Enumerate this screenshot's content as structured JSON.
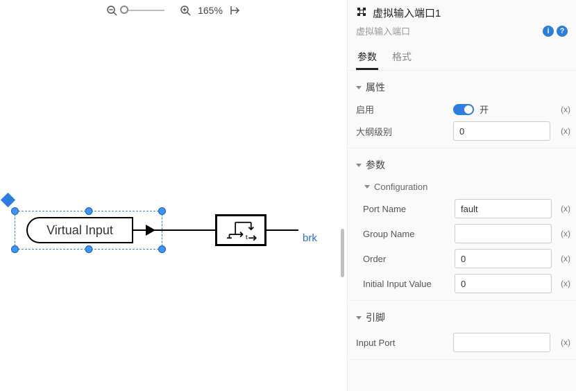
{
  "toolbar": {
    "zoom_value": "165%"
  },
  "canvas": {
    "virtual_input_label": "Virtual Input",
    "port_label": "brk"
  },
  "panel": {
    "title": "虚拟输入端口1",
    "subtitle": "虚拟输入端口",
    "tabs": {
      "params": "参数",
      "format": "格式"
    },
    "sections": {
      "attrs": {
        "title": "属性",
        "enable": {
          "label": "启用",
          "state_label": "开"
        },
        "outline_level": {
          "label": "大纲级别",
          "value": "0"
        }
      },
      "params": {
        "title": "参数",
        "config": {
          "title": "Configuration",
          "port_name": {
            "label": "Port Name",
            "value": "fault"
          },
          "group_name": {
            "label": "Group Name",
            "value": ""
          },
          "order": {
            "label": "Order",
            "value": "0"
          },
          "initial_input": {
            "label": "Initial Input Value",
            "value": "0"
          }
        }
      },
      "pins": {
        "title": "引脚",
        "input_port": {
          "label": "Input Port",
          "value": ""
        }
      }
    },
    "x_btn": "(x)"
  }
}
